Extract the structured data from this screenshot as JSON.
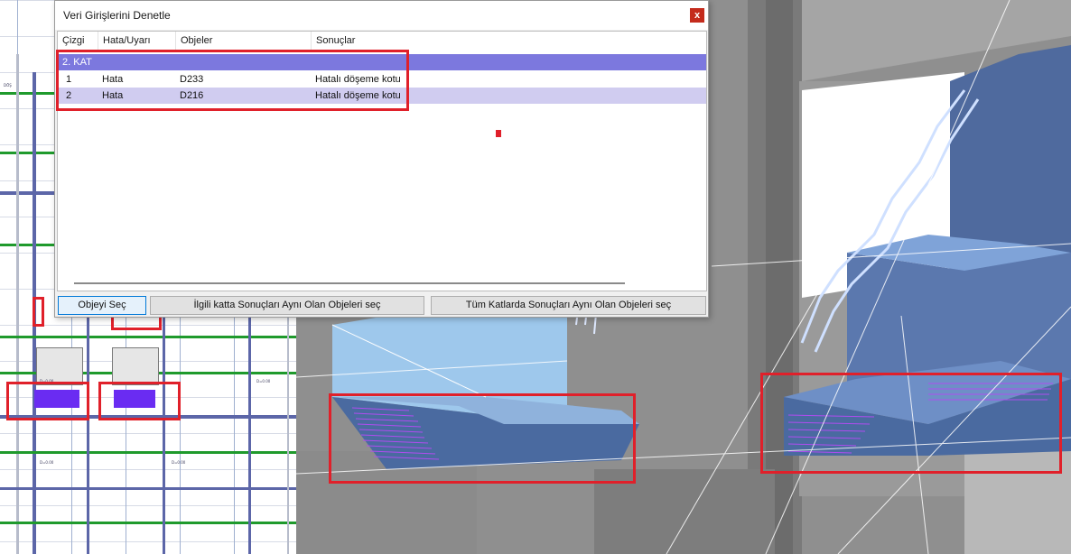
{
  "dialog": {
    "title": "Veri Girişlerini Denetle",
    "close_glyph": "x",
    "columns": [
      "Çizgi",
      "Hata/Uyarı",
      "Objeler",
      "Sonuçlar"
    ],
    "group_label": "2. KAT",
    "rows": [
      {
        "line": "1",
        "type": "Hata",
        "object": "D233",
        "result": "Hatalı döşeme kotu"
      },
      {
        "line": "2",
        "type": "Hata",
        "object": "D216",
        "result": "Hatalı döşeme kotu"
      }
    ],
    "buttons": {
      "select_object": "Objeyi Seç",
      "select_same_floor": "İlgili katta Sonuçları Aynı Olan Objeleri seç",
      "select_all_floors": "Tüm Katlarda Sonuçları Aynı Olan Objeleri seç"
    }
  },
  "colors": {
    "group_row": "#7c78de",
    "selected_row": "#d0ccf0",
    "highlight": "#e0202a",
    "slab_error": "#6a2cf2",
    "slab_blue": "#4a6aa0"
  },
  "plan_view": {
    "labels": [
      "DÖŞ",
      "D=0.00",
      "D=0.00",
      "D=0.00",
      "D=0.00"
    ]
  }
}
